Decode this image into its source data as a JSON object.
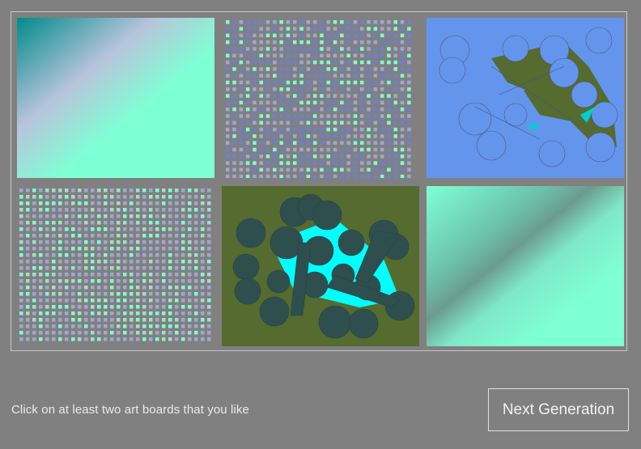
{
  "instruction": "Click on at least two art boards that you like",
  "next_button_label": "Next Generation",
  "colors": {
    "page_background": "#808080",
    "gallery_border": "#c8c8c8",
    "teal": "#008b8b",
    "lavender": "#b8c4dc",
    "aquamarine": "#7fffd4",
    "cornflower": "#6495ed",
    "olive": "#556b2f",
    "dark_slate": "#2f4f4f",
    "cyan": "#00ffff",
    "dot_blue": "#6a7fd8",
    "dot_lavender": "#a0a8d0"
  },
  "art_boards": [
    {
      "id": "gradient-teal-lavender"
    },
    {
      "id": "dot-grid-blue-aqua"
    },
    {
      "id": "circles-on-cornflower"
    },
    {
      "id": "dot-grid-lavender-aqua"
    },
    {
      "id": "circles-on-olive"
    },
    {
      "id": "gradient-aqua-diagonal"
    }
  ]
}
